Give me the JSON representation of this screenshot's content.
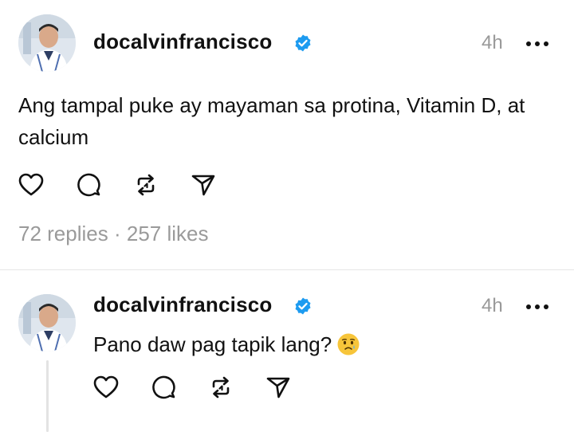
{
  "post": {
    "username": "docalvinfrancisco",
    "time": "4h",
    "text": "Ang tampal puke ay mayaman sa protina, Vitamin D, at calcium",
    "replies_text": "72 replies",
    "separator": "·",
    "likes_text": "257 likes"
  },
  "reply": {
    "username": "docalvinfrancisco",
    "time": "4h",
    "text": "Pano daw pag tapik lang?"
  },
  "icons": {
    "verified": "verified-badge-icon",
    "more": "more-options-icon",
    "like": "heart-icon",
    "comment": "comment-icon",
    "repost": "repost-icon",
    "share": "send-icon",
    "emoji": "sad-relieved-face-emoji"
  },
  "colors": {
    "verified_blue": "#1d9bf0",
    "muted_gray": "#999999",
    "text": "#111111",
    "divider": "#e6e6e6"
  }
}
